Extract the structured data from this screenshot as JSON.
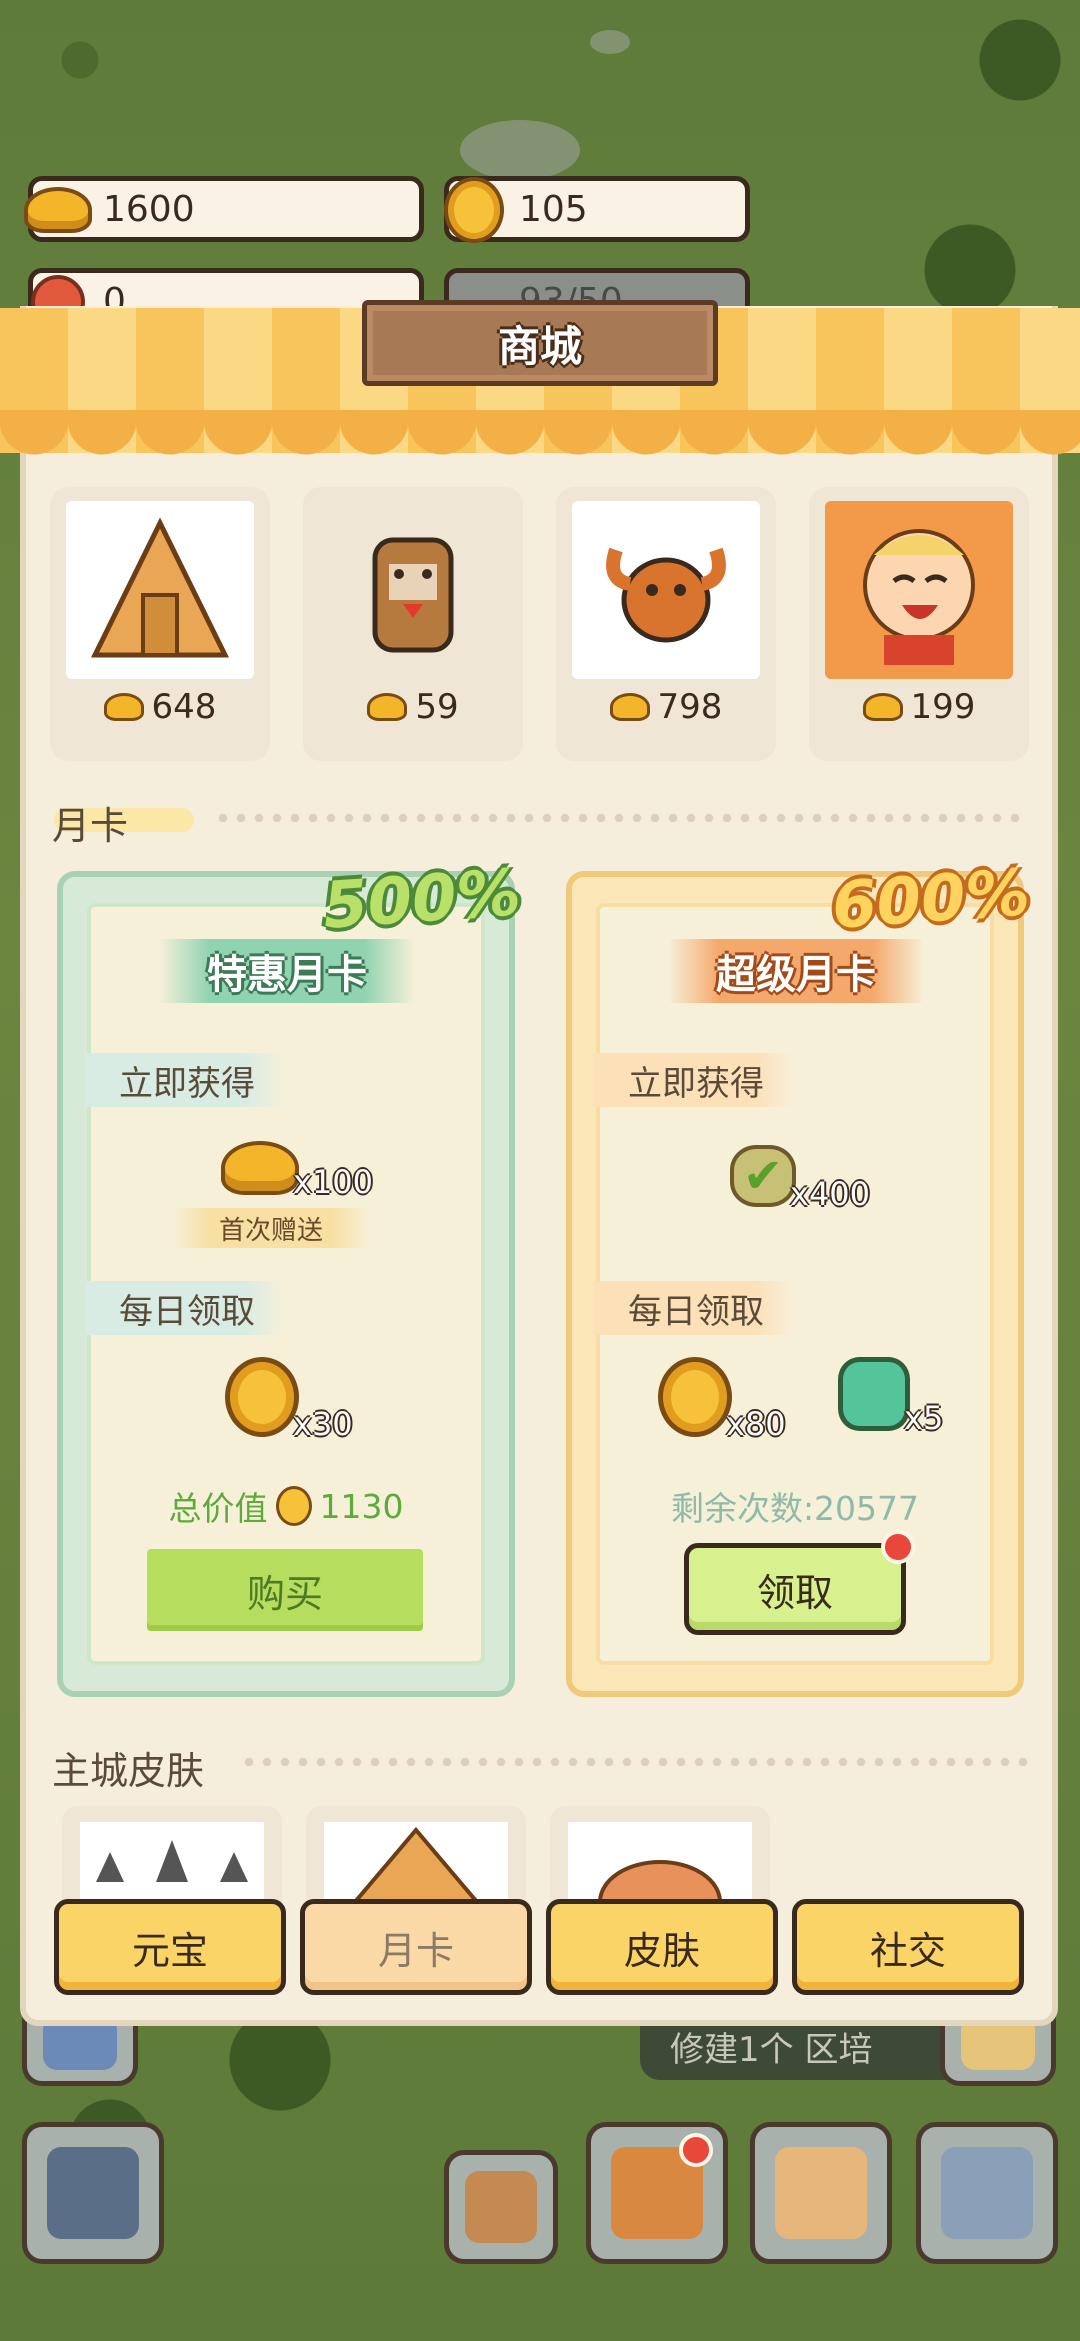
{
  "resources": {
    "ingot_value": "1600",
    "coin_value": "105",
    "badge_value": "0",
    "capacity_value": "93/50"
  },
  "panel": {
    "title": "商城"
  },
  "featured": [
    {
      "price": "648",
      "icon": "pyramid-art"
    },
    {
      "price": "59",
      "icon": "dog-pet-art"
    },
    {
      "price": "798",
      "icon": "crab-warrior-art"
    },
    {
      "price": "199",
      "icon": "laughing-child-art"
    }
  ],
  "monthly": {
    "section_title": "月卡",
    "card1": {
      "percent": "500%",
      "title": "特惠月卡",
      "instant_label": "立即获得",
      "instant_qty": "x100",
      "first_gift": "首次赠送",
      "daily_label": "每日领取",
      "daily_qty": "x30",
      "total_label": "总价值",
      "total_value": "1130",
      "button": "购买"
    },
    "card2": {
      "percent": "600%",
      "title": "超级月卡",
      "instant_label": "立即获得",
      "instant_qty": "x400",
      "daily_label": "每日领取",
      "daily_qty1": "x80",
      "daily_qty2": "x5",
      "remaining": "剩余次数:20577",
      "button": "领取"
    }
  },
  "skins": {
    "section_title": "主城皮肤"
  },
  "tabs": [
    "元宝",
    "月卡",
    "皮肤",
    "社交"
  ],
  "chat_text": "修建1个 区培",
  "colors": {
    "accent_yellow": "#fbd467",
    "green_card": "#d7ead7",
    "orange_card": "#fbe6b8"
  }
}
